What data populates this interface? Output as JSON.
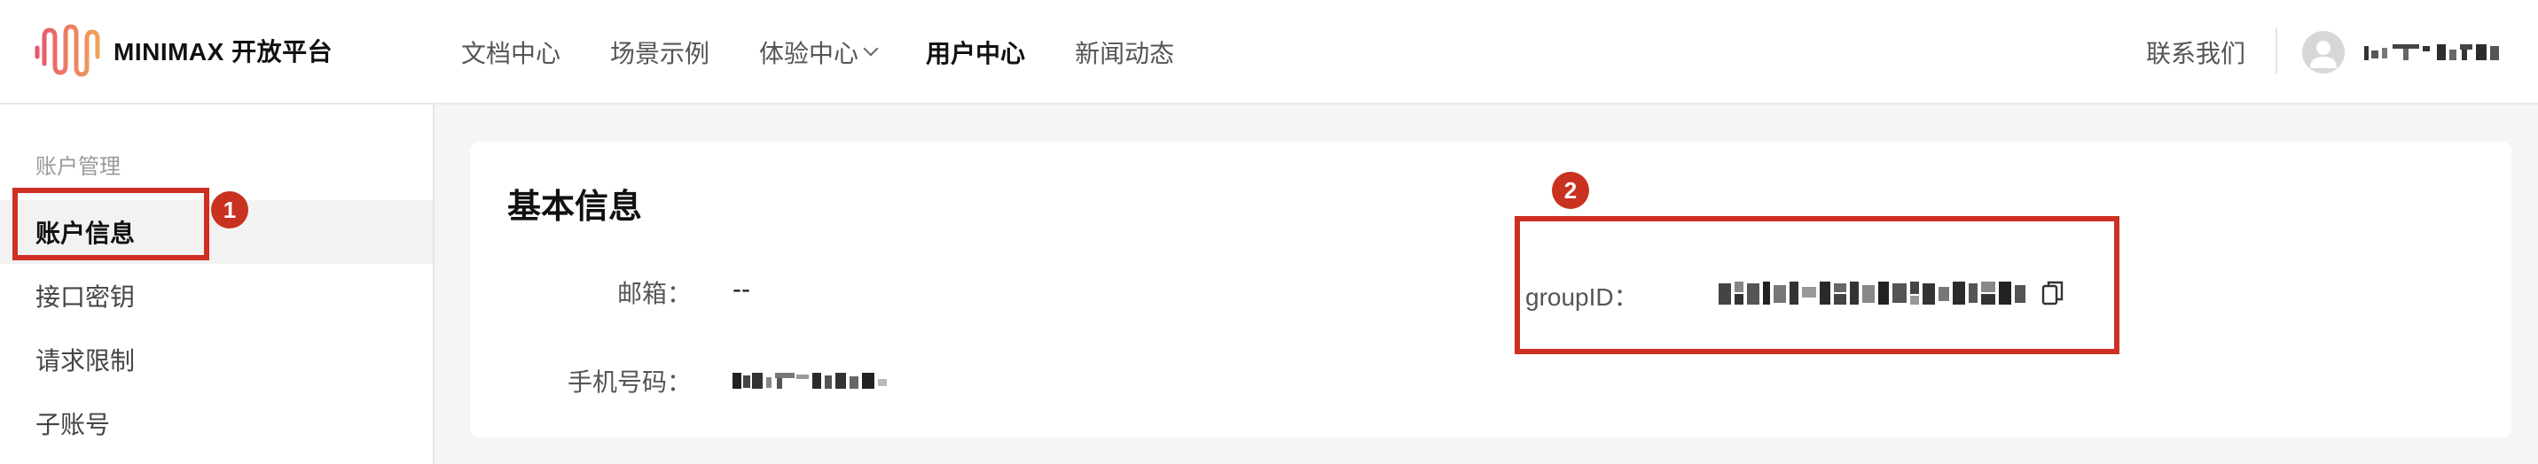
{
  "header": {
    "brand": "MINIMAX 开放平台",
    "nav": [
      {
        "label": "文档中心"
      },
      {
        "label": "场景示例"
      },
      {
        "label": "体验中心"
      },
      {
        "label": "用户中心"
      },
      {
        "label": "新闻动态"
      }
    ],
    "contact": "联系我们"
  },
  "sidebar": {
    "group_title": "账户管理",
    "items": [
      {
        "label": "账户信息"
      },
      {
        "label": "接口密钥"
      },
      {
        "label": "请求限制"
      },
      {
        "label": "子账号"
      }
    ]
  },
  "card": {
    "title": "基本信息",
    "email_label": "邮箱：",
    "email_value": "--",
    "phone_label": "手机号码：",
    "group_label": "groupID："
  },
  "annotations": {
    "badge_1": "1",
    "badge_2": "2"
  },
  "colors": {
    "accent": "#cf2f23",
    "logo_gradient_start": "#e9546b",
    "logo_gradient_end": "#f0a35a"
  }
}
